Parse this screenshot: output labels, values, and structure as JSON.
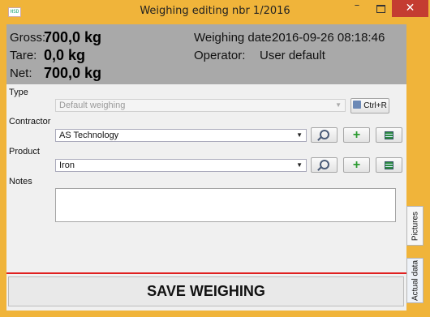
{
  "window": {
    "title": "Weighing editing nbr 1/2016",
    "app_icon": "HSD",
    "minimize": "–",
    "close": "✕"
  },
  "info": {
    "gross_label": "Gross:",
    "gross_value": "700,0 kg",
    "tare_label": "Tare:",
    "tare_value": "0,0 kg",
    "net_label": "Net:",
    "net_value": "700,0 kg",
    "date_label": "Weighing date:",
    "date_value": "2016-09-26 08:18:46",
    "operator_label": "Operator:",
    "operator_value": "User default"
  },
  "form": {
    "type_label": "Type",
    "type_value": "Default weighing",
    "ctrl_button": "Ctrl+R",
    "contractor_label": "Contractor",
    "contractor_value": "AS Technology",
    "product_label": "Product",
    "product_value": "Iron",
    "notes_label": "Notes",
    "notes_value": ""
  },
  "tabs": {
    "pictures": "Pictures",
    "actual_data": "Actual data"
  },
  "save_button": "SAVE WEIGHING",
  "colors": {
    "titlebar": "#f0b43a",
    "info_panel": "#a9a9a9",
    "rule": "#e02020"
  }
}
